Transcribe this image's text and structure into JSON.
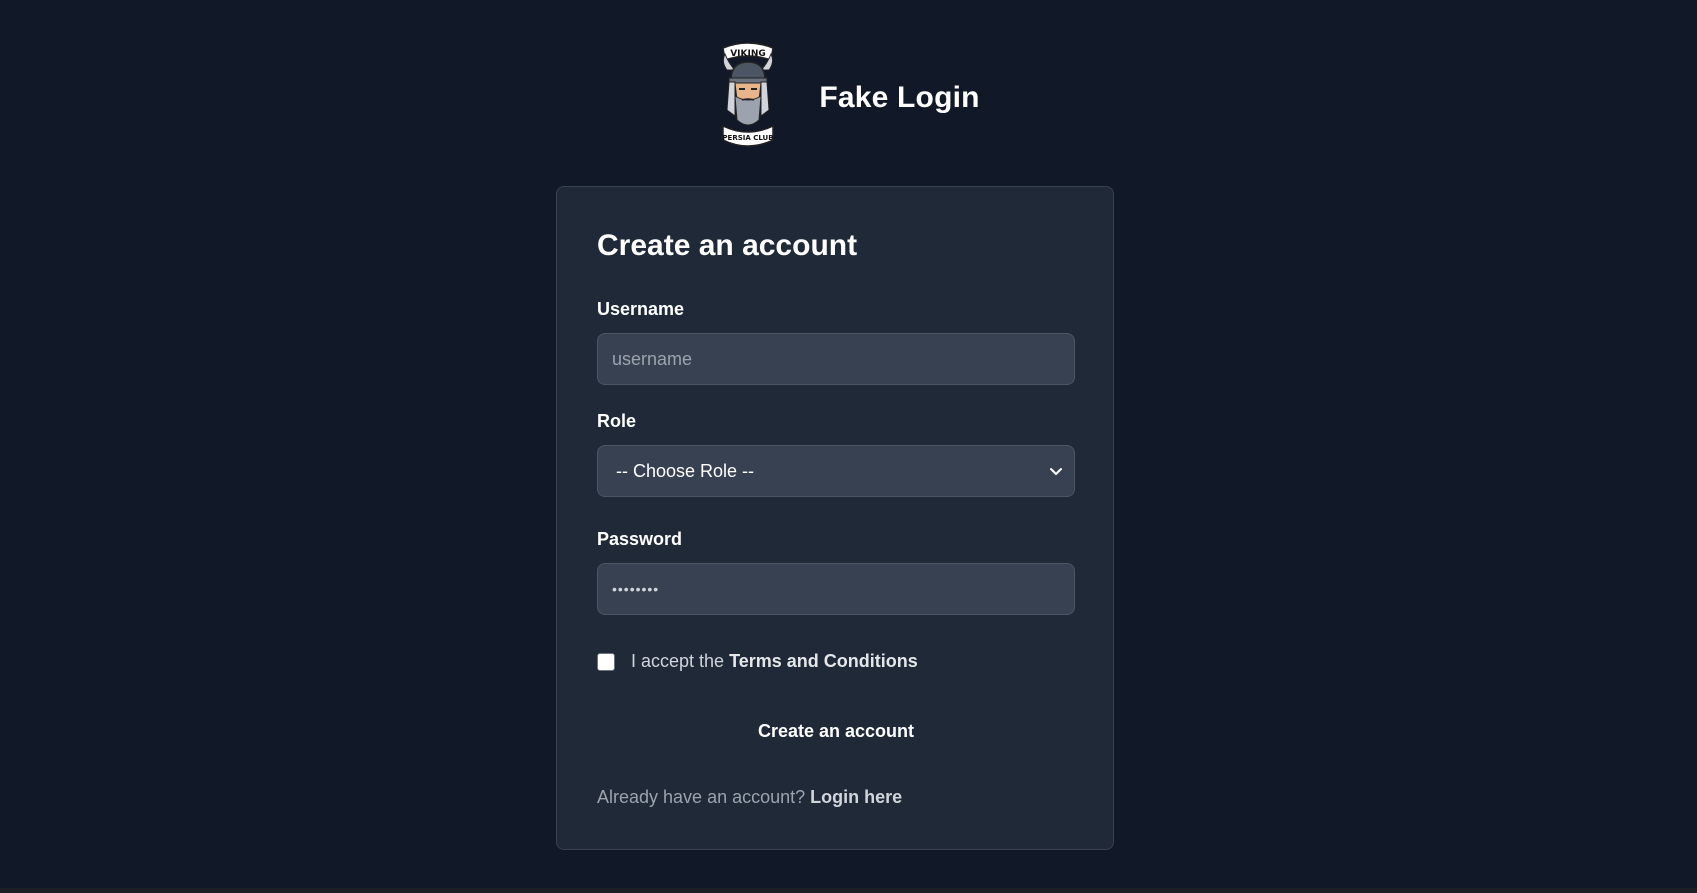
{
  "brand": {
    "name": "Fake Login",
    "logo_icon": "viking-persia-club-logo"
  },
  "form": {
    "title": "Create an account",
    "username": {
      "label": "Username",
      "placeholder": "username",
      "value": ""
    },
    "role": {
      "label": "Role",
      "selected": "-- Choose Role --"
    },
    "password": {
      "label": "Password",
      "value_masked": "••••••••"
    },
    "terms": {
      "prefix": "I accept the",
      "link": "Terms and Conditions",
      "checked": false
    },
    "submit_label": "Create an account",
    "login": {
      "prompt": "Already have an account?",
      "link": "Login here"
    }
  },
  "colors": {
    "background": "#111827",
    "card": "#1f2937",
    "input": "#374151",
    "text": "#ffffff",
    "muted": "#9ca3af"
  }
}
